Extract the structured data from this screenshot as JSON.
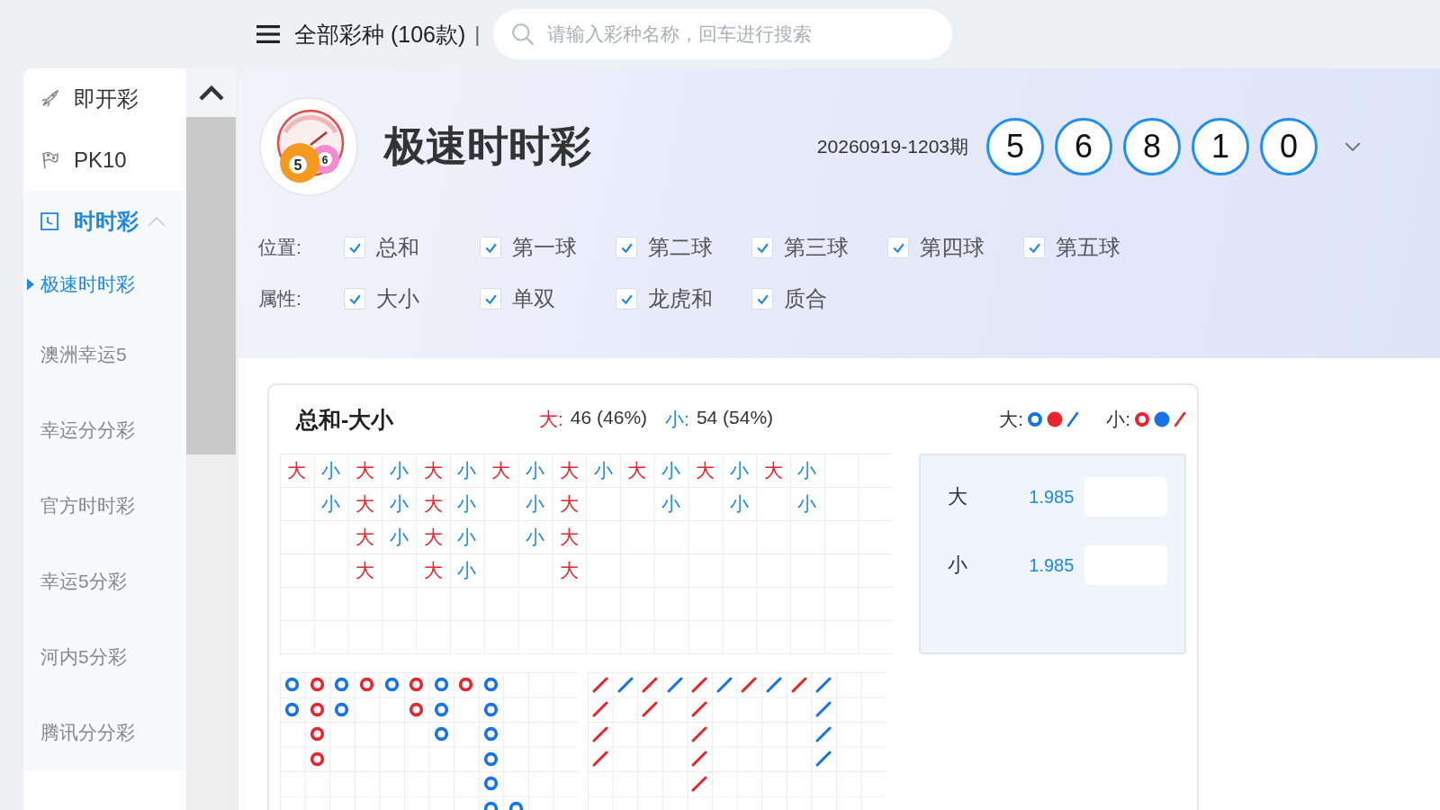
{
  "top_bar": {
    "menu_title": "全部彩种 (106款)",
    "separator": "|",
    "search": {
      "placeholder": "请输入彩种名称，回车进行搜索"
    }
  },
  "sidebar": {
    "items": [
      {
        "label": "即开彩",
        "kind": "instant",
        "selected": false
      },
      {
        "label": "PK10",
        "kind": "race",
        "selected": false
      },
      {
        "label": "时时彩",
        "kind": "timed",
        "selected": true,
        "expanded": true,
        "children": [
          {
            "label": "极速时时彩",
            "selected": true
          },
          {
            "label": "澳洲幸运5",
            "selected": false
          },
          {
            "label": "幸运分分彩",
            "selected": false
          },
          {
            "label": "官方时时彩",
            "selected": false
          },
          {
            "label": "幸运5分彩",
            "selected": false
          },
          {
            "label": "河内5分彩",
            "selected": false
          },
          {
            "label": "腾讯分分彩",
            "selected": false
          }
        ]
      }
    ]
  },
  "header": {
    "logo_numbers": [
      "5",
      "6"
    ],
    "title": "极速时时彩",
    "issue": "20260919-1203期",
    "balls": [
      "5",
      "6",
      "8",
      "1",
      "0"
    ]
  },
  "filters": [
    {
      "label": "位置:",
      "options": [
        {
          "label": "总和",
          "checked": true
        },
        {
          "label": "第一球",
          "checked": true
        },
        {
          "label": "第二球",
          "checked": true
        },
        {
          "label": "第三球",
          "checked": true
        },
        {
          "label": "第四球",
          "checked": true
        },
        {
          "label": "第五球",
          "checked": true
        }
      ]
    },
    {
      "label": "属性:",
      "options": [
        {
          "label": "大小",
          "checked": true
        },
        {
          "label": "单双",
          "checked": true
        },
        {
          "label": "龙虎和",
          "checked": true
        },
        {
          "label": "质合",
          "checked": true
        }
      ]
    }
  ],
  "trend_card": {
    "title": "总和-大小",
    "stats": [
      {
        "kind": "big",
        "label": "大:",
        "value": "46 (46%)"
      },
      {
        "kind": "small",
        "label": "小:",
        "value": "54 (54%)"
      }
    ],
    "legend": [
      {
        "kind": "big",
        "label": "大:"
      },
      {
        "kind": "small",
        "label": "小:"
      }
    ],
    "big_road": [
      {
        "kind": "big",
        "cells": [
          "大"
        ]
      },
      {
        "kind": "small",
        "cells": [
          "小",
          "小"
        ]
      },
      {
        "kind": "big",
        "cells": [
          "大",
          "大",
          "大",
          "大"
        ]
      },
      {
        "kind": "small",
        "cells": [
          "小",
          "小",
          "小"
        ]
      },
      {
        "kind": "big",
        "cells": [
          "大",
          "大",
          "大",
          "大"
        ]
      },
      {
        "kind": "small",
        "cells": [
          "小",
          "小",
          "小",
          "小"
        ]
      },
      {
        "kind": "big",
        "cells": [
          "大"
        ]
      },
      {
        "kind": "small",
        "cells": [
          "小",
          "小",
          "小"
        ]
      },
      {
        "kind": "big",
        "cells": [
          "大",
          "大",
          "大",
          "大"
        ]
      },
      {
        "kind": "small",
        "cells": [
          "小"
        ]
      },
      {
        "kind": "big",
        "cells": [
          "大"
        ]
      },
      {
        "kind": "small",
        "cells": [
          "小",
          "小"
        ]
      },
      {
        "kind": "big",
        "cells": [
          "大"
        ]
      },
      {
        "kind": "small",
        "cells": [
          "小",
          "小"
        ]
      },
      {
        "kind": "big",
        "cells": [
          "大"
        ]
      },
      {
        "kind": "small",
        "cells": [
          "小",
          "小"
        ]
      }
    ],
    "odds": [
      {
        "label": "大",
        "odds": "1.985"
      },
      {
        "label": "小",
        "odds": "1.985"
      }
    ],
    "ring_road": [
      [
        {
          "kind": "big"
        },
        {
          "kind": "big"
        }
      ],
      [
        {
          "kind": "small"
        },
        {
          "kind": "small"
        },
        {
          "kind": "small"
        },
        {
          "kind": "small"
        }
      ],
      [
        {
          "kind": "big"
        },
        {
          "kind": "big"
        }
      ],
      [
        {
          "kind": "small"
        }
      ],
      [
        {
          "kind": "big"
        }
      ],
      [
        {
          "kind": "small"
        },
        {
          "kind": "small"
        }
      ],
      [
        {
          "kind": "big"
        },
        {
          "kind": "big"
        },
        {
          "kind": "big"
        }
      ],
      [
        {
          "kind": "small"
        }
      ],
      [
        {
          "kind": "big"
        },
        {
          "kind": "big"
        },
        {
          "kind": "big"
        },
        {
          "kind": "big"
        },
        {
          "kind": "big"
        },
        {
          "kind": "big"
        }
      ],
      [
        {
          "kind": "blank"
        },
        {
          "kind": "blank"
        },
        {
          "kind": "blank"
        },
        {
          "kind": "blank"
        },
        {
          "kind": "blank"
        },
        {
          "kind": "big"
        }
      ]
    ],
    "slash_road": [
      [
        {
          "kind": "small"
        },
        {
          "kind": "small"
        },
        {
          "kind": "small"
        },
        {
          "kind": "small"
        }
      ],
      [
        {
          "kind": "big"
        }
      ],
      [
        {
          "kind": "small"
        },
        {
          "kind": "small"
        }
      ],
      [
        {
          "kind": "big"
        }
      ],
      [
        {
          "kind": "small"
        },
        {
          "kind": "small"
        },
        {
          "kind": "small"
        },
        {
          "kind": "small"
        },
        {
          "kind": "small"
        }
      ],
      [
        {
          "kind": "big"
        }
      ],
      [
        {
          "kind": "small"
        }
      ],
      [
        {
          "kind": "big"
        }
      ],
      [
        {
          "kind": "small"
        }
      ],
      [
        {
          "kind": "big"
        },
        {
          "kind": "big"
        },
        {
          "kind": "big"
        },
        {
          "kind": "big"
        }
      ]
    ]
  }
}
